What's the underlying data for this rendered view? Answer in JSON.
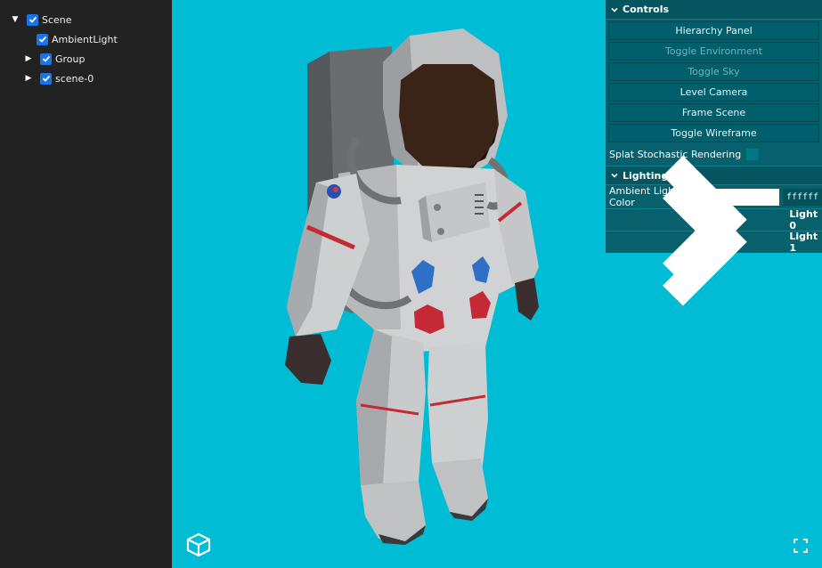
{
  "hierarchy": {
    "items": [
      {
        "label": "Scene",
        "expanded": true,
        "checked": true
      },
      {
        "label": "AmbientLight",
        "checked": true
      },
      {
        "label": "Group",
        "expanded": false,
        "checked": true
      },
      {
        "label": "scene-0",
        "expanded": false,
        "checked": true
      }
    ]
  },
  "controls": {
    "title": "Controls",
    "buttons": [
      {
        "label": "Hierarchy Panel",
        "enabled": true
      },
      {
        "label": "Toggle Environment",
        "enabled": false
      },
      {
        "label": "Toggle Sky",
        "enabled": false
      },
      {
        "label": "Level Camera",
        "enabled": true
      },
      {
        "label": "Frame Scene",
        "enabled": true
      },
      {
        "label": "Toggle Wireframe",
        "enabled": true
      }
    ],
    "splat_label": "Splat Stochastic Rendering",
    "splat_checked": false
  },
  "lighting": {
    "title": "Lighting",
    "ambient_label": "Ambient Light Color",
    "ambient_hex": "ffffff",
    "ambient_color": "#ffffff",
    "lights": [
      "Light 0",
      "Light 1"
    ]
  },
  "colors": {
    "viewport_bg": "#00bcd4",
    "panel_bg": "#07606b",
    "checkbox_blue": "#1a73e8"
  }
}
